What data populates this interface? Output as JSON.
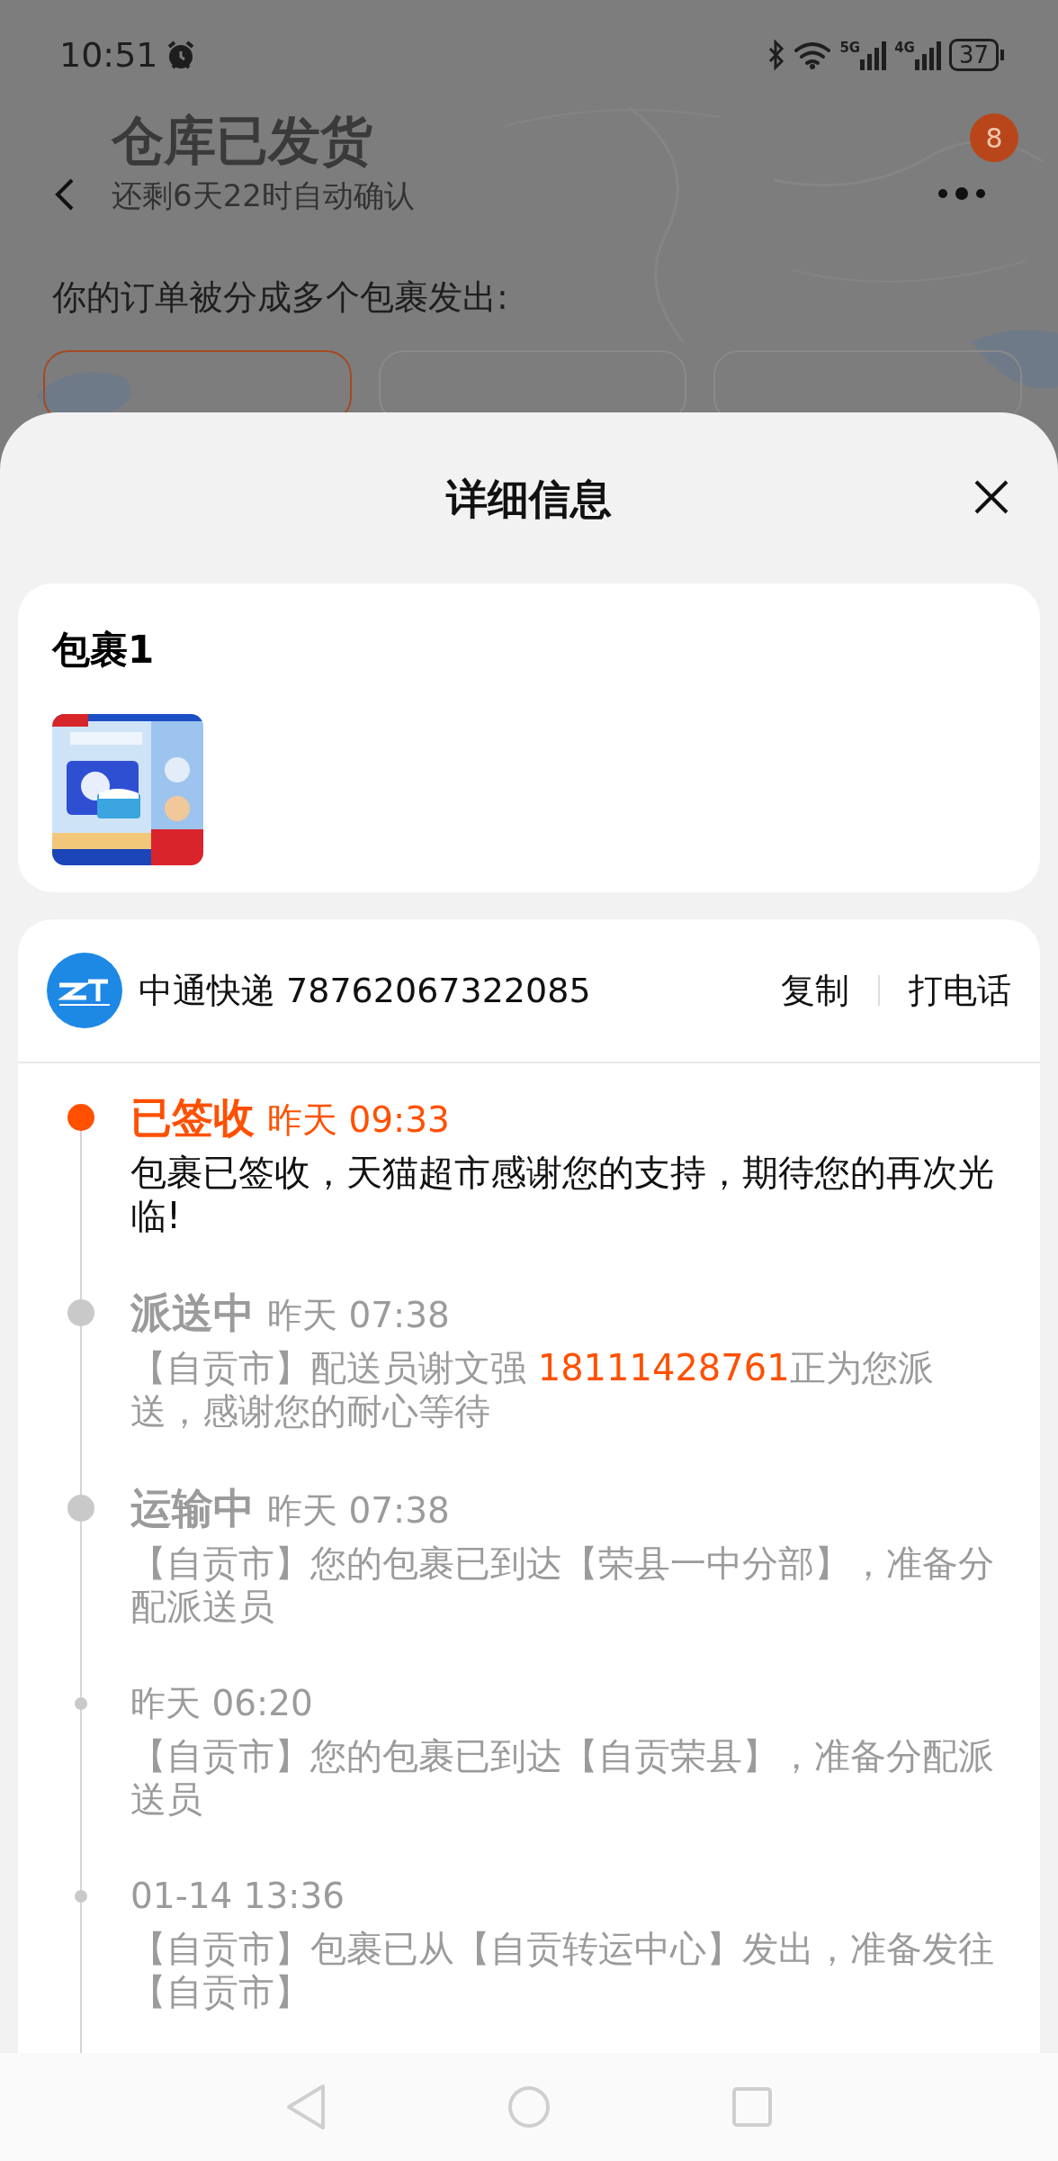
{
  "status_bar": {
    "time": "10:51",
    "networks": [
      "5G",
      "4G"
    ],
    "battery": "37"
  },
  "order_header": {
    "title": "仓库已发货",
    "subtitle": "还剩6天22时自动确认",
    "notification_count": "8",
    "split_notice": "你的订单被分成多个包裹发出:"
  },
  "package_tabs": [
    {
      "selected": true
    },
    {
      "selected": false
    },
    {
      "selected": false
    }
  ],
  "sheet": {
    "title": "详细信息"
  },
  "package": {
    "name": "包裹1"
  },
  "shipment": {
    "carrier": "中通快递 78762067322085",
    "actions": [
      "复制",
      "打电话"
    ]
  },
  "timeline": [
    {
      "kind": "milestone",
      "current": true,
      "status": "已签收",
      "time": "昨天 09:33",
      "segments": [
        {
          "text": "包裹已签收，天猫超市感谢您的支持，期待您的再次光临!"
        }
      ]
    },
    {
      "kind": "milestone",
      "current": false,
      "status": "派送中",
      "time": "昨天 07:38",
      "segments": [
        {
          "text": "【自贡市】配送员谢文强 "
        },
        {
          "text": "18111428761",
          "kind": "phone"
        },
        {
          "text": "正为您派送，感谢您的耐心等待"
        }
      ]
    },
    {
      "kind": "milestone",
      "current": false,
      "status": "运输中",
      "time": "昨天 07:38",
      "segments": [
        {
          "text": "【自贡市】您的包裹已到达【荣县一中分部】，准备分配派送员"
        }
      ]
    },
    {
      "kind": "minor",
      "current": false,
      "time": "昨天 06:20",
      "segments": [
        {
          "text": "【自贡市】您的包裹已到达【自贡荣县】，准备分配派送员"
        }
      ]
    },
    {
      "kind": "minor",
      "current": false,
      "time": "01-14 13:36",
      "segments": [
        {
          "text": "【自贡市】包裹已从【自贡转运中心】发出，准备发往【自贡市】"
        }
      ]
    }
  ]
}
